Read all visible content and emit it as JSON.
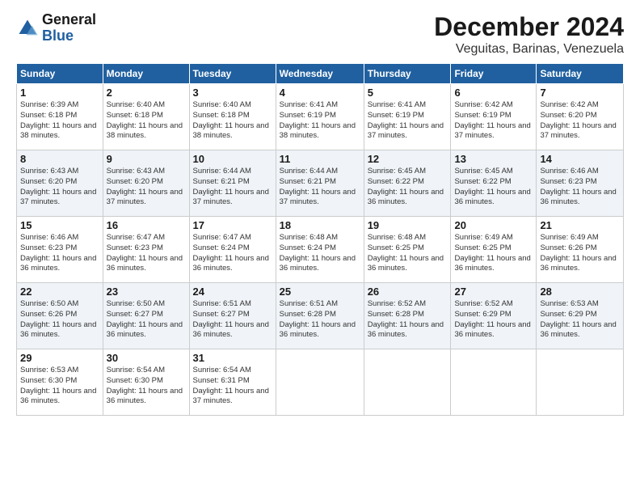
{
  "header": {
    "logo": {
      "general": "General",
      "blue": "Blue"
    },
    "title": "December 2024",
    "subtitle": "Veguitas, Barinas, Venezuela"
  },
  "calendar": {
    "days_of_week": [
      "Sunday",
      "Monday",
      "Tuesday",
      "Wednesday",
      "Thursday",
      "Friday",
      "Saturday"
    ],
    "weeks": [
      [
        {
          "day": "1",
          "sunrise": "6:39 AM",
          "sunset": "6:18 PM",
          "daylight": "11 hours and 38 minutes."
        },
        {
          "day": "2",
          "sunrise": "6:40 AM",
          "sunset": "6:18 PM",
          "daylight": "11 hours and 38 minutes."
        },
        {
          "day": "3",
          "sunrise": "6:40 AM",
          "sunset": "6:18 PM",
          "daylight": "11 hours and 38 minutes."
        },
        {
          "day": "4",
          "sunrise": "6:41 AM",
          "sunset": "6:19 PM",
          "daylight": "11 hours and 38 minutes."
        },
        {
          "day": "5",
          "sunrise": "6:41 AM",
          "sunset": "6:19 PM",
          "daylight": "11 hours and 37 minutes."
        },
        {
          "day": "6",
          "sunrise": "6:42 AM",
          "sunset": "6:19 PM",
          "daylight": "11 hours and 37 minutes."
        },
        {
          "day": "7",
          "sunrise": "6:42 AM",
          "sunset": "6:20 PM",
          "daylight": "11 hours and 37 minutes."
        }
      ],
      [
        {
          "day": "8",
          "sunrise": "6:43 AM",
          "sunset": "6:20 PM",
          "daylight": "11 hours and 37 minutes."
        },
        {
          "day": "9",
          "sunrise": "6:43 AM",
          "sunset": "6:20 PM",
          "daylight": "11 hours and 37 minutes."
        },
        {
          "day": "10",
          "sunrise": "6:44 AM",
          "sunset": "6:21 PM",
          "daylight": "11 hours and 37 minutes."
        },
        {
          "day": "11",
          "sunrise": "6:44 AM",
          "sunset": "6:21 PM",
          "daylight": "11 hours and 37 minutes."
        },
        {
          "day": "12",
          "sunrise": "6:45 AM",
          "sunset": "6:22 PM",
          "daylight": "11 hours and 36 minutes."
        },
        {
          "day": "13",
          "sunrise": "6:45 AM",
          "sunset": "6:22 PM",
          "daylight": "11 hours and 36 minutes."
        },
        {
          "day": "14",
          "sunrise": "6:46 AM",
          "sunset": "6:23 PM",
          "daylight": "11 hours and 36 minutes."
        }
      ],
      [
        {
          "day": "15",
          "sunrise": "6:46 AM",
          "sunset": "6:23 PM",
          "daylight": "11 hours and 36 minutes."
        },
        {
          "day": "16",
          "sunrise": "6:47 AM",
          "sunset": "6:23 PM",
          "daylight": "11 hours and 36 minutes."
        },
        {
          "day": "17",
          "sunrise": "6:47 AM",
          "sunset": "6:24 PM",
          "daylight": "11 hours and 36 minutes."
        },
        {
          "day": "18",
          "sunrise": "6:48 AM",
          "sunset": "6:24 PM",
          "daylight": "11 hours and 36 minutes."
        },
        {
          "day": "19",
          "sunrise": "6:48 AM",
          "sunset": "6:25 PM",
          "daylight": "11 hours and 36 minutes."
        },
        {
          "day": "20",
          "sunrise": "6:49 AM",
          "sunset": "6:25 PM",
          "daylight": "11 hours and 36 minutes."
        },
        {
          "day": "21",
          "sunrise": "6:49 AM",
          "sunset": "6:26 PM",
          "daylight": "11 hours and 36 minutes."
        }
      ],
      [
        {
          "day": "22",
          "sunrise": "6:50 AM",
          "sunset": "6:26 PM",
          "daylight": "11 hours and 36 minutes."
        },
        {
          "day": "23",
          "sunrise": "6:50 AM",
          "sunset": "6:27 PM",
          "daylight": "11 hours and 36 minutes."
        },
        {
          "day": "24",
          "sunrise": "6:51 AM",
          "sunset": "6:27 PM",
          "daylight": "11 hours and 36 minutes."
        },
        {
          "day": "25",
          "sunrise": "6:51 AM",
          "sunset": "6:28 PM",
          "daylight": "11 hours and 36 minutes."
        },
        {
          "day": "26",
          "sunrise": "6:52 AM",
          "sunset": "6:28 PM",
          "daylight": "11 hours and 36 minutes."
        },
        {
          "day": "27",
          "sunrise": "6:52 AM",
          "sunset": "6:29 PM",
          "daylight": "11 hours and 36 minutes."
        },
        {
          "day": "28",
          "sunrise": "6:53 AM",
          "sunset": "6:29 PM",
          "daylight": "11 hours and 36 minutes."
        }
      ],
      [
        {
          "day": "29",
          "sunrise": "6:53 AM",
          "sunset": "6:30 PM",
          "daylight": "11 hours and 36 minutes."
        },
        {
          "day": "30",
          "sunrise": "6:54 AM",
          "sunset": "6:30 PM",
          "daylight": "11 hours and 36 minutes."
        },
        {
          "day": "31",
          "sunrise": "6:54 AM",
          "sunset": "6:31 PM",
          "daylight": "11 hours and 37 minutes."
        },
        null,
        null,
        null,
        null
      ]
    ]
  }
}
